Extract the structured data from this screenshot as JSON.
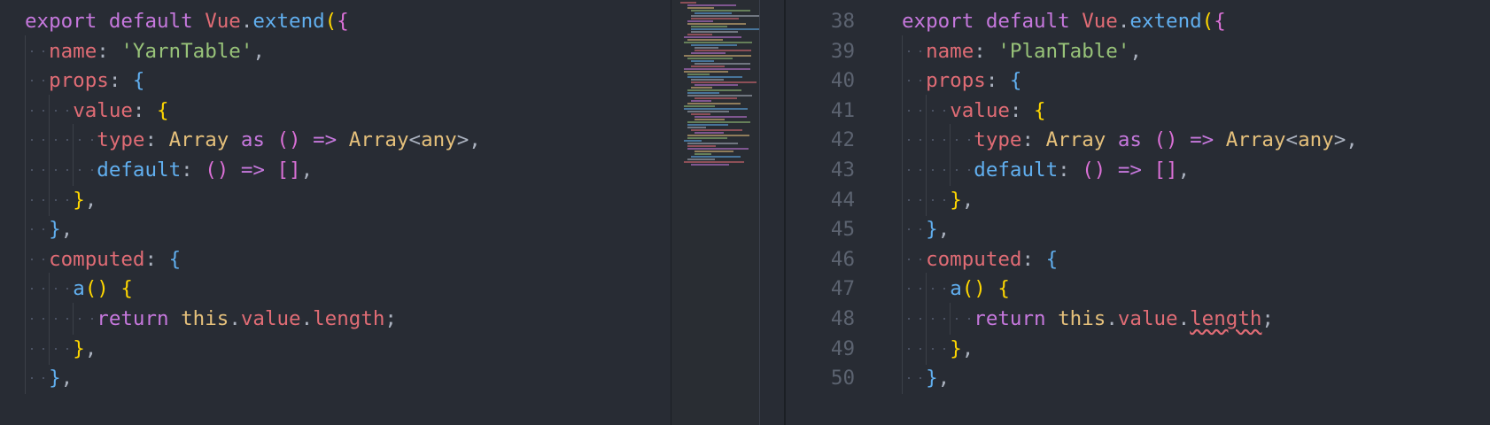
{
  "editor": {
    "theme_colors": {
      "background": "#282c34",
      "keyword": "#c678dd",
      "identifier": "#e06c75",
      "function": "#61afef",
      "string": "#98c379",
      "type": "#e5c07b",
      "bracket_yellow": "#ffd700",
      "bracket_pink": "#da70d6",
      "bracket_blue": "#61afef",
      "line_number": "#5c6370",
      "error_squiggle": "#e06c75"
    },
    "left_pane": {
      "lines": [
        {
          "indent": 0,
          "tokens": [
            [
              "k",
              "export"
            ],
            [
              "p",
              " "
            ],
            [
              "k",
              "default"
            ],
            [
              "p",
              " "
            ],
            [
              "cls",
              "Vue"
            ],
            [
              "p",
              "."
            ],
            [
              "fn",
              "extend"
            ],
            [
              "brace-y",
              "("
            ],
            [
              "brace-p",
              "{"
            ]
          ]
        },
        {
          "indent": 1,
          "tokens": [
            [
              "prop",
              "name"
            ],
            [
              "p",
              ": "
            ],
            [
              "str",
              "'YarnTable'"
            ],
            [
              "p",
              ","
            ]
          ]
        },
        {
          "indent": 1,
          "tokens": [
            [
              "prop",
              "props"
            ],
            [
              "p",
              ": "
            ],
            [
              "brace-b",
              "{"
            ]
          ]
        },
        {
          "indent": 2,
          "tokens": [
            [
              "prop",
              "value"
            ],
            [
              "p",
              ": "
            ],
            [
              "brace-y",
              "{"
            ]
          ]
        },
        {
          "indent": 3,
          "tokens": [
            [
              "prop",
              "type"
            ],
            [
              "p",
              ": "
            ],
            [
              "type",
              "Array"
            ],
            [
              "p",
              " "
            ],
            [
              "k",
              "as"
            ],
            [
              "p",
              " "
            ],
            [
              "brace-p",
              "()"
            ],
            [
              "p",
              " "
            ],
            [
              "k",
              "=>"
            ],
            [
              "p",
              " "
            ],
            [
              "type",
              "Array"
            ],
            [
              "p",
              "<"
            ],
            [
              "type",
              "any"
            ],
            [
              "p",
              ">,"
            ]
          ]
        },
        {
          "indent": 3,
          "tokens": [
            [
              "fn",
              "default"
            ],
            [
              "p",
              ": "
            ],
            [
              "brace-p",
              "()"
            ],
            [
              "p",
              " "
            ],
            [
              "k",
              "=>"
            ],
            [
              "p",
              " "
            ],
            [
              "brace-p",
              "[]"
            ],
            [
              "p",
              ","
            ]
          ]
        },
        {
          "indent": 2,
          "tokens": [
            [
              "brace-y",
              "}"
            ],
            [
              "p",
              ","
            ]
          ]
        },
        {
          "indent": 1,
          "tokens": [
            [
              "brace-b",
              "}"
            ],
            [
              "p",
              ","
            ]
          ]
        },
        {
          "indent": 1,
          "tokens": [
            [
              "prop",
              "computed"
            ],
            [
              "p",
              ": "
            ],
            [
              "brace-b",
              "{"
            ]
          ]
        },
        {
          "indent": 2,
          "tokens": [
            [
              "fn",
              "a"
            ],
            [
              "brace-y",
              "()"
            ],
            [
              "p",
              " "
            ],
            [
              "brace-y",
              "{"
            ]
          ]
        },
        {
          "indent": 3,
          "tokens": [
            [
              "k",
              "return"
            ],
            [
              "p",
              " "
            ],
            [
              "this",
              "this"
            ],
            [
              "p",
              "."
            ],
            [
              "prop",
              "value"
            ],
            [
              "p",
              "."
            ],
            [
              "prop",
              "length"
            ],
            [
              "p",
              ";"
            ]
          ]
        },
        {
          "indent": 2,
          "tokens": [
            [
              "brace-y",
              "}"
            ],
            [
              "p",
              ","
            ]
          ]
        },
        {
          "indent": 1,
          "tokens": [
            [
              "brace-b",
              "}"
            ],
            [
              "p",
              ","
            ]
          ]
        }
      ]
    },
    "right_pane": {
      "lines": [
        {
          "number": "38",
          "indent": 0,
          "tokens": [
            [
              "k",
              "export"
            ],
            [
              "p",
              " "
            ],
            [
              "k",
              "default"
            ],
            [
              "p",
              " "
            ],
            [
              "cls",
              "Vue"
            ],
            [
              "p",
              "."
            ],
            [
              "fn",
              "extend"
            ],
            [
              "brace-y",
              "("
            ],
            [
              "brace-p",
              "{"
            ]
          ]
        },
        {
          "number": "39",
          "indent": 1,
          "tokens": [
            [
              "prop",
              "name"
            ],
            [
              "p",
              ": "
            ],
            [
              "str",
              "'PlanTable'"
            ],
            [
              "p",
              ","
            ]
          ]
        },
        {
          "number": "40",
          "indent": 1,
          "tokens": [
            [
              "prop",
              "props"
            ],
            [
              "p",
              ": "
            ],
            [
              "brace-b",
              "{"
            ]
          ]
        },
        {
          "number": "41",
          "indent": 2,
          "tokens": [
            [
              "prop",
              "value"
            ],
            [
              "p",
              ": "
            ],
            [
              "brace-y",
              "{"
            ]
          ]
        },
        {
          "number": "42",
          "indent": 3,
          "tokens": [
            [
              "prop",
              "type"
            ],
            [
              "p",
              ": "
            ],
            [
              "type",
              "Array"
            ],
            [
              "p",
              " "
            ],
            [
              "k",
              "as"
            ],
            [
              "p",
              " "
            ],
            [
              "brace-p",
              "()"
            ],
            [
              "p",
              " "
            ],
            [
              "k",
              "=>"
            ],
            [
              "p",
              " "
            ],
            [
              "type",
              "Array"
            ],
            [
              "p",
              "<"
            ],
            [
              "type",
              "any"
            ],
            [
              "p",
              ">,"
            ]
          ]
        },
        {
          "number": "43",
          "indent": 3,
          "tokens": [
            [
              "fn",
              "default"
            ],
            [
              "p",
              ": "
            ],
            [
              "brace-p",
              "()"
            ],
            [
              "p",
              " "
            ],
            [
              "k",
              "=>"
            ],
            [
              "p",
              " "
            ],
            [
              "brace-p",
              "[]"
            ],
            [
              "p",
              ","
            ]
          ]
        },
        {
          "number": "44",
          "indent": 2,
          "tokens": [
            [
              "brace-y",
              "}"
            ],
            [
              "p",
              ","
            ]
          ]
        },
        {
          "number": "45",
          "indent": 1,
          "tokens": [
            [
              "brace-b",
              "}"
            ],
            [
              "p",
              ","
            ]
          ]
        },
        {
          "number": "46",
          "indent": 1,
          "tokens": [
            [
              "prop",
              "computed"
            ],
            [
              "p",
              ": "
            ],
            [
              "brace-b",
              "{"
            ]
          ]
        },
        {
          "number": "47",
          "indent": 2,
          "tokens": [
            [
              "fn",
              "a"
            ],
            [
              "brace-y",
              "()"
            ],
            [
              "p",
              " "
            ],
            [
              "brace-y",
              "{"
            ]
          ]
        },
        {
          "number": "48",
          "indent": 3,
          "tokens": [
            [
              "k",
              "return"
            ],
            [
              "p",
              " "
            ],
            [
              "this",
              "this"
            ],
            [
              "p",
              "."
            ],
            [
              "prop",
              "value"
            ],
            [
              "p",
              "."
            ],
            [
              "prop squiggle",
              "length"
            ],
            [
              "p",
              ";"
            ]
          ]
        },
        {
          "number": "49",
          "indent": 2,
          "tokens": [
            [
              "brace-y",
              "}"
            ],
            [
              "p",
              ","
            ]
          ]
        },
        {
          "number": "50",
          "indent": 1,
          "tokens": [
            [
              "brace-b",
              "}"
            ],
            [
              "p",
              ","
            ]
          ]
        }
      ]
    }
  }
}
